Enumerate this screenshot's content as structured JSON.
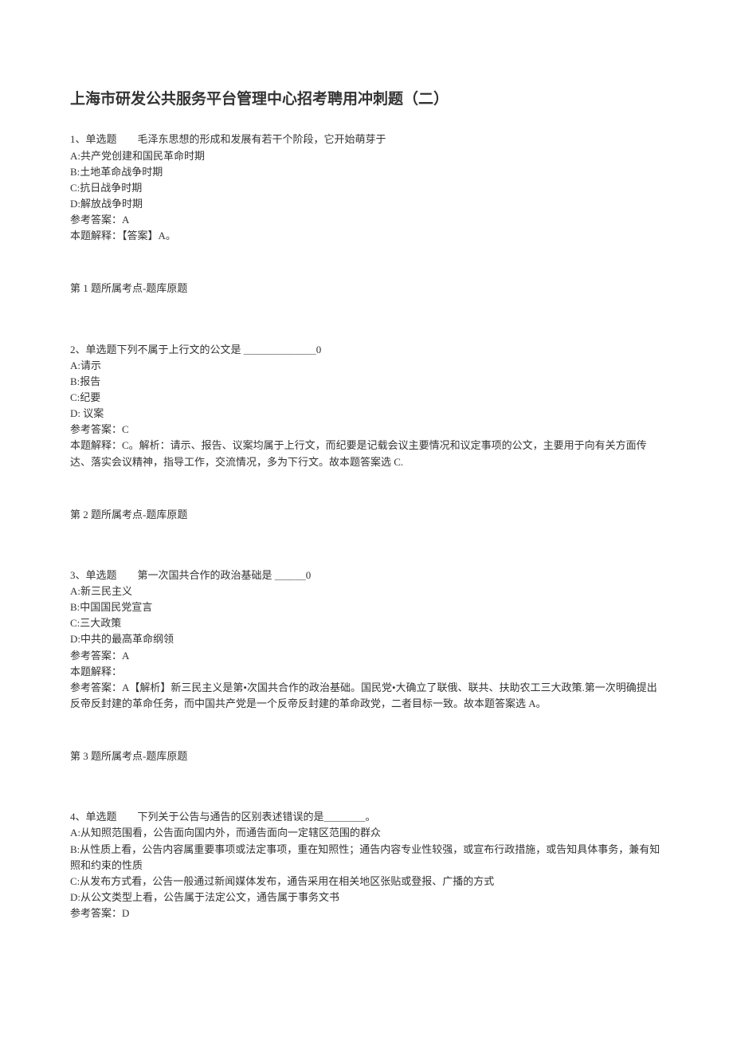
{
  "title": "上海市研发公共服务平台管理中心招考聘用冲刺题（二）",
  "questions": [
    {
      "stem": "1、单选题　　毛泽东思想的形成和发展有若干个阶段，它开始萌芽于",
      "options": [
        "A:共产党创建和国民革命时期",
        "B:土地革命战争时期",
        "C:抗日战争时期",
        "D:解放战争时期"
      ],
      "answer": "参考答案：A",
      "explain": "本题解释：【答案】A。",
      "tag": "第 1 题所属考点-题库原题"
    },
    {
      "stem": "2、单选题下列不属于上行文的公文是 ＿＿＿＿＿＿＿0",
      "options": [
        "A:请示",
        "B:报告",
        "C:纪要",
        "D: 议案"
      ],
      "answer": "参考答案：C",
      "explain": "本题解释：C。解析：请示、报告、议案均属于上行文，而纪要是记载会议主要情况和议定事项的公文，主要用于向有关方面传达、落实会议精神，指导工作，交流情况，多为下行文。故本题答案选 C.",
      "tag": "第 2 题所属考点-题库原题"
    },
    {
      "stem": "3、单选题　　第一次国共合作的政治基础是 ＿＿＿0",
      "options": [
        "A:新三民主义",
        "B:中国国民党宣言",
        "C:三大政策",
        "D:中共的最高革命纲领"
      ],
      "answer": "参考答案：A",
      "explain": "本题解释：\n参考答案：A【解析】新三民主义是第•次国共合作的政治基础。国民党•大确立了联俄、联共、扶助农工三大政策.第一次明确提出反帝反封建的革命任务，而中国共产党是一个反帝反封建的革命政党，二者目标一致。故本题答案选 A。",
      "tag": "第 3 题所属考点-题库原题"
    },
    {
      "stem": "4、单选题　　下列关于公告与通告的区别表述错误的是＿＿＿＿。",
      "options": [
        "A:从知照范围看，公告面向国内外，而通告面向一定辖区范围的群众",
        "B:从性质上看，公告内容属重要事项或法定事项，重在知照性；通告内容专业性较强，或宣布行政措施，或告知具体事务，兼有知照和约束的性质",
        "C:从发布方式看，公告一般通过新闻媒体发布，通告采用在相关地区张贴或登报、广播的方式",
        "D:从公文类型上看，公告属于法定公文，通告属于事务文书"
      ],
      "answer": "参考答案：D",
      "explain": "",
      "tag": ""
    }
  ]
}
